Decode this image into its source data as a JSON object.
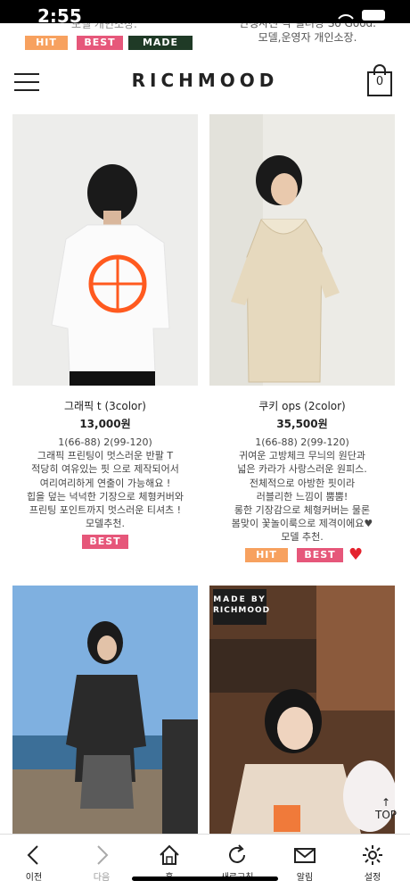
{
  "status_bar": {
    "time": "2:55"
  },
  "top_strip": {
    "left_text": "모델 개인소장.",
    "right_text": "인생사진 각 킬러장 So Good.\n모델,운영자 개인소장.",
    "badges": [
      "HIT",
      "BEST",
      "MADE"
    ]
  },
  "header": {
    "logo": "RICHMOOD",
    "cart_count": "0"
  },
  "products": [
    {
      "name": "그래픽 t (3color)",
      "price": "13,000원",
      "desc": "1(66-88) 2(99-120)\n그래픽 프린팅이 멋스러운 반팔 T\n적당히 여유있는 핏 으로 제작되어서\n여리여리하게 연출이 가능해요 !\n힙을 덮는 넉넉한 기장으로 체형커버와\n프린팅 포인트까지 멋스러운 티셔츠 !\n모델추천.",
      "badges": [
        "BEST"
      ]
    },
    {
      "name": "쿠키 ops (2color)",
      "price": "35,500원",
      "desc": "1(66-88) 2(99-120)\n귀여운 고방체크 무늬의 원단과\n넓은 카라가 사랑스러운 원피스.\n전체적으로 아방한 핏이라\n러블리한 느낌이 뿜뿜!\n롱한 기장감으로 체형커버는 물론\n봄맞이 꽃놀이룩으로 제격이에요♥\n모델 추천.",
      "badges": [
        "HIT",
        "BEST"
      ],
      "liked": true
    },
    {
      "name": "",
      "price": "",
      "desc": "",
      "badges": []
    },
    {
      "name": "",
      "price": "",
      "desc": "",
      "badges": [],
      "overlay": [
        "MADE BY",
        "RICHMOOD"
      ]
    }
  ],
  "top_button": {
    "arrow": "↑",
    "label": "TOP"
  },
  "tabbar": {
    "items": [
      {
        "label": "이전",
        "icon": "back-icon"
      },
      {
        "label": "다음",
        "icon": "forward-icon"
      },
      {
        "label": "홈",
        "icon": "home-icon"
      },
      {
        "label": "새로고침",
        "icon": "refresh-icon"
      },
      {
        "label": "알림",
        "icon": "mail-icon"
      },
      {
        "label": "설정",
        "icon": "gear-icon"
      }
    ]
  },
  "colors": {
    "hit": "#f7a15f",
    "best": "#e6577a",
    "made": "#1f3a26",
    "heart": "#e4222d"
  }
}
